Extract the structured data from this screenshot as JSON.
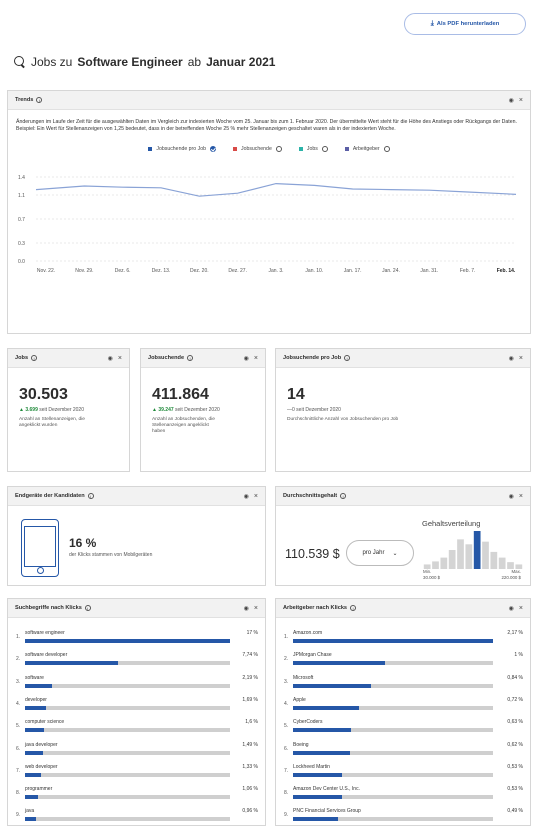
{
  "header": {
    "pdf_button": "Als PDF herunterladen",
    "pdf_icon": "download-icon",
    "title_prefix": "Jobs zu",
    "title_job": "Software Engineer",
    "title_mid": "ab",
    "title_date": "Januar 2021"
  },
  "colors": {
    "accent": "#2557a7",
    "series_red": "#d84a47",
    "series_teal": "#2bb3a8",
    "series_purple": "#5b5ea6",
    "up": "#1f8a3a"
  },
  "trends": {
    "title": "Trends",
    "description": "Änderungen im Laufe der Zeit für die ausgewählten Daten im Vergleich zur indexierten Woche vom 25. Januar bis zum 1. Februar 2020. Der übermittelte Wert steht für die Höhe des Anstiegs oder Rückgangs der Daten. Beispiel: Ein Wert für Stellenanzeigen von 1,25 bedeutet, dass in der betreffenden Woche 25 % mehr Stellenanzeigen geschaltet waren als in der indexierten Woche.",
    "legend": [
      {
        "label": "Jobsuchende pro Job",
        "color": "#2557a7",
        "checked": true
      },
      {
        "label": "Jobsuchende",
        "color": "#d84a47",
        "checked": false
      },
      {
        "label": "Jobs",
        "color": "#2bb3a8",
        "checked": false
      },
      {
        "label": "Arbeitgeber",
        "color": "#5b5ea6",
        "checked": false
      }
    ]
  },
  "chart_data": {
    "type": "line",
    "title": "",
    "xlabel": "",
    "ylabel": "",
    "ylim": [
      0.0,
      1.4
    ],
    "yticks": [
      "0.0",
      "0.3",
      "0.7",
      "1.1",
      "1.4"
    ],
    "categories": [
      "Nov. 22.",
      "Nov. 29.",
      "Dez. 6.",
      "Dez. 13.",
      "Dez. 20.",
      "Dez. 27.",
      "Jan. 3.",
      "Jan. 10.",
      "Jan. 17.",
      "Jan. 24.",
      "Jan. 31.",
      "Feb. 7.",
      "Feb. 14."
    ],
    "series": [
      {
        "name": "Jobsuchende pro Job",
        "values": [
          1.19,
          1.25,
          1.23,
          1.22,
          1.08,
          1.13,
          1.29,
          1.26,
          1.2,
          1.19,
          1.18,
          1.15,
          1.12
        ]
      }
    ],
    "grid": true,
    "legend": "top-center"
  },
  "stats": [
    {
      "title": "Jobs",
      "value": "30.503",
      "delta": "3.699",
      "delta_suffix": "seit Dezember 2020",
      "sub": "Anzahl an Stellenanzeigen, die angeklickt wurden"
    },
    {
      "title": "Jobsuchende",
      "value": "411.864",
      "delta": "39.247",
      "delta_suffix": "seit Dezember 2020",
      "sub": "Anzahl an Jobsuchenden, die Stellenanzeigen angeklickt haben"
    },
    {
      "title": "Jobsuchende pro Job",
      "value": "14",
      "delta": "0",
      "delta_suffix": "seit Dezember 2020",
      "sub": "Durchschnittliche Anzahl von Jobsuchenden pro Job"
    }
  ],
  "devices": {
    "title": "Endgeräte der Kandidaten",
    "value": "16 %",
    "sub": "der Klicks stammen von Mobilgeräten"
  },
  "salary": {
    "title": "Durchschnittsgehalt",
    "value": "110.539 $",
    "period": "pro Jahr",
    "hist_title": "Gehaltsverteilung",
    "min_label": "Min.",
    "min_value": "30.000 $",
    "max_label": "Max.",
    "max_value": "220.000 $",
    "hist_values": [
      0.12,
      0.2,
      0.3,
      0.5,
      0.78,
      0.65,
      1.0,
      0.72,
      0.45,
      0.3,
      0.18,
      0.12
    ]
  },
  "keywords": {
    "title": "Suchbegriffe nach Klicks",
    "items": [
      {
        "num": "1.",
        "label": "software engineer",
        "value": "17 %",
        "fraction": 1.0
      },
      {
        "num": "2.",
        "label": "software developer",
        "value": "7,74 %",
        "fraction": 0.455
      },
      {
        "num": "3.",
        "label": "software",
        "value": "2,19 %",
        "fraction": 0.13
      },
      {
        "num": "4.",
        "label": "developer",
        "value": "1,69 %",
        "fraction": 0.1
      },
      {
        "num": "5.",
        "label": "computer science",
        "value": "1,6 %",
        "fraction": 0.094
      },
      {
        "num": "6.",
        "label": "java developer",
        "value": "1,49 %",
        "fraction": 0.088
      },
      {
        "num": "7.",
        "label": "web developer",
        "value": "1,33 %",
        "fraction": 0.078
      },
      {
        "num": "8.",
        "label": "programmer",
        "value": "1,06 %",
        "fraction": 0.062
      },
      {
        "num": "9.",
        "label": "java",
        "value": "0,96 %",
        "fraction": 0.056
      }
    ]
  },
  "employers": {
    "title": "Arbeitgeber nach Klicks",
    "items": [
      {
        "num": "1.",
        "label": "Amazon.com",
        "value": "2,17 %",
        "fraction": 1.0
      },
      {
        "num": "2.",
        "label": "JPMorgan Chase",
        "value": "1 %",
        "fraction": 0.46
      },
      {
        "num": "3.",
        "label": "Microsoft",
        "value": "0,84 %",
        "fraction": 0.39
      },
      {
        "num": "4.",
        "label": "Apple",
        "value": "0,72 %",
        "fraction": 0.33
      },
      {
        "num": "5.",
        "label": "CyberCoders",
        "value": "0,63 %",
        "fraction": 0.29
      },
      {
        "num": "6.",
        "label": "Boeing",
        "value": "0,62 %",
        "fraction": 0.285
      },
      {
        "num": "7.",
        "label": "Lockheed Martin",
        "value": "0,53 %",
        "fraction": 0.245
      },
      {
        "num": "8.",
        "label": "Amazon Dev Center U.S., Inc.",
        "value": "0,53 %",
        "fraction": 0.245
      },
      {
        "num": "9.",
        "label": "PNC Financial Services Group",
        "value": "0,49 %",
        "fraction": 0.225
      }
    ]
  }
}
